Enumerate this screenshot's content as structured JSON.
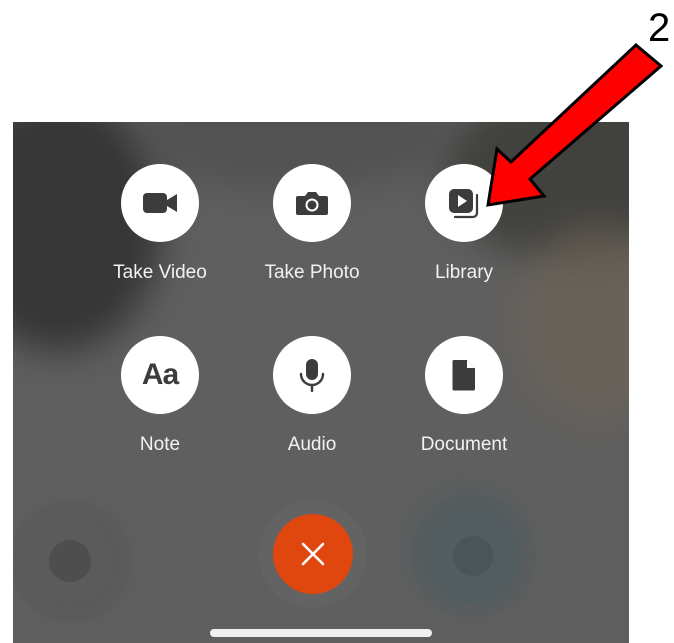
{
  "annotation": {
    "number": "2"
  },
  "actions": [
    {
      "id": "take-video",
      "label": "Take Video",
      "icon": "video-camera-icon"
    },
    {
      "id": "take-photo",
      "label": "Take Photo",
      "icon": "camera-icon"
    },
    {
      "id": "library",
      "label": "Library",
      "icon": "media-library-icon"
    },
    {
      "id": "note",
      "label": "Note",
      "icon": "text-note-icon",
      "glyph": "Aa"
    },
    {
      "id": "audio",
      "label": "Audio",
      "icon": "microphone-icon"
    },
    {
      "id": "document",
      "label": "Document",
      "icon": "document-icon"
    }
  ],
  "close": {
    "icon": "close-icon"
  },
  "colors": {
    "overlay": "#5f5f5f",
    "action_circle": "#ffffff",
    "icon": "#3c3c3c",
    "label": "#f2f2f2",
    "close_button": "#e0470f",
    "arrow": "#ff0000"
  }
}
